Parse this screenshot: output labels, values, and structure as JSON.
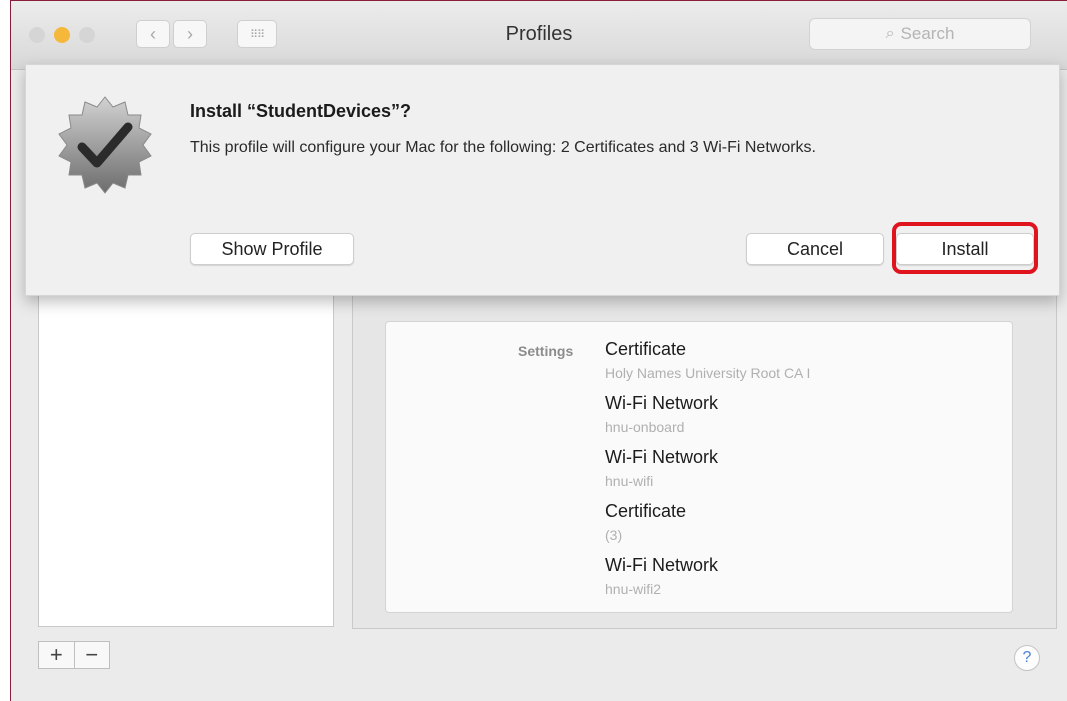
{
  "window": {
    "title": "Profiles"
  },
  "toolbar": {
    "back_glyph": "‹",
    "forward_glyph": "›",
    "grid_glyph": "⠿⠿",
    "search_placeholder": "Search",
    "search_icon": "search-icon"
  },
  "dialog": {
    "title": "Install “StudentDevices”?",
    "message": "This profile will configure your Mac for the following: 2 Certificates and 3 Wi-Fi Networks.",
    "show_profile_label": "Show Profile",
    "cancel_label": "Cancel",
    "install_label": "Install",
    "highlight_color": "#e0141e",
    "icon": "verified-checkmark-badge-icon"
  },
  "settings": {
    "label": "Settings",
    "items": [
      {
        "title": "Certificate",
        "subtitle": "Holy Names University Root CA I"
      },
      {
        "title": "Wi-Fi Network",
        "subtitle": "hnu-onboard"
      },
      {
        "title": "Wi-Fi Network",
        "subtitle": "hnu-wifi"
      },
      {
        "title": "Certificate",
        "subtitle": "(3)"
      },
      {
        "title": "Wi-Fi Network",
        "subtitle": "hnu-wifi2"
      }
    ]
  },
  "footer": {
    "add_label": "+",
    "remove_label": "−",
    "help_label": "?"
  }
}
